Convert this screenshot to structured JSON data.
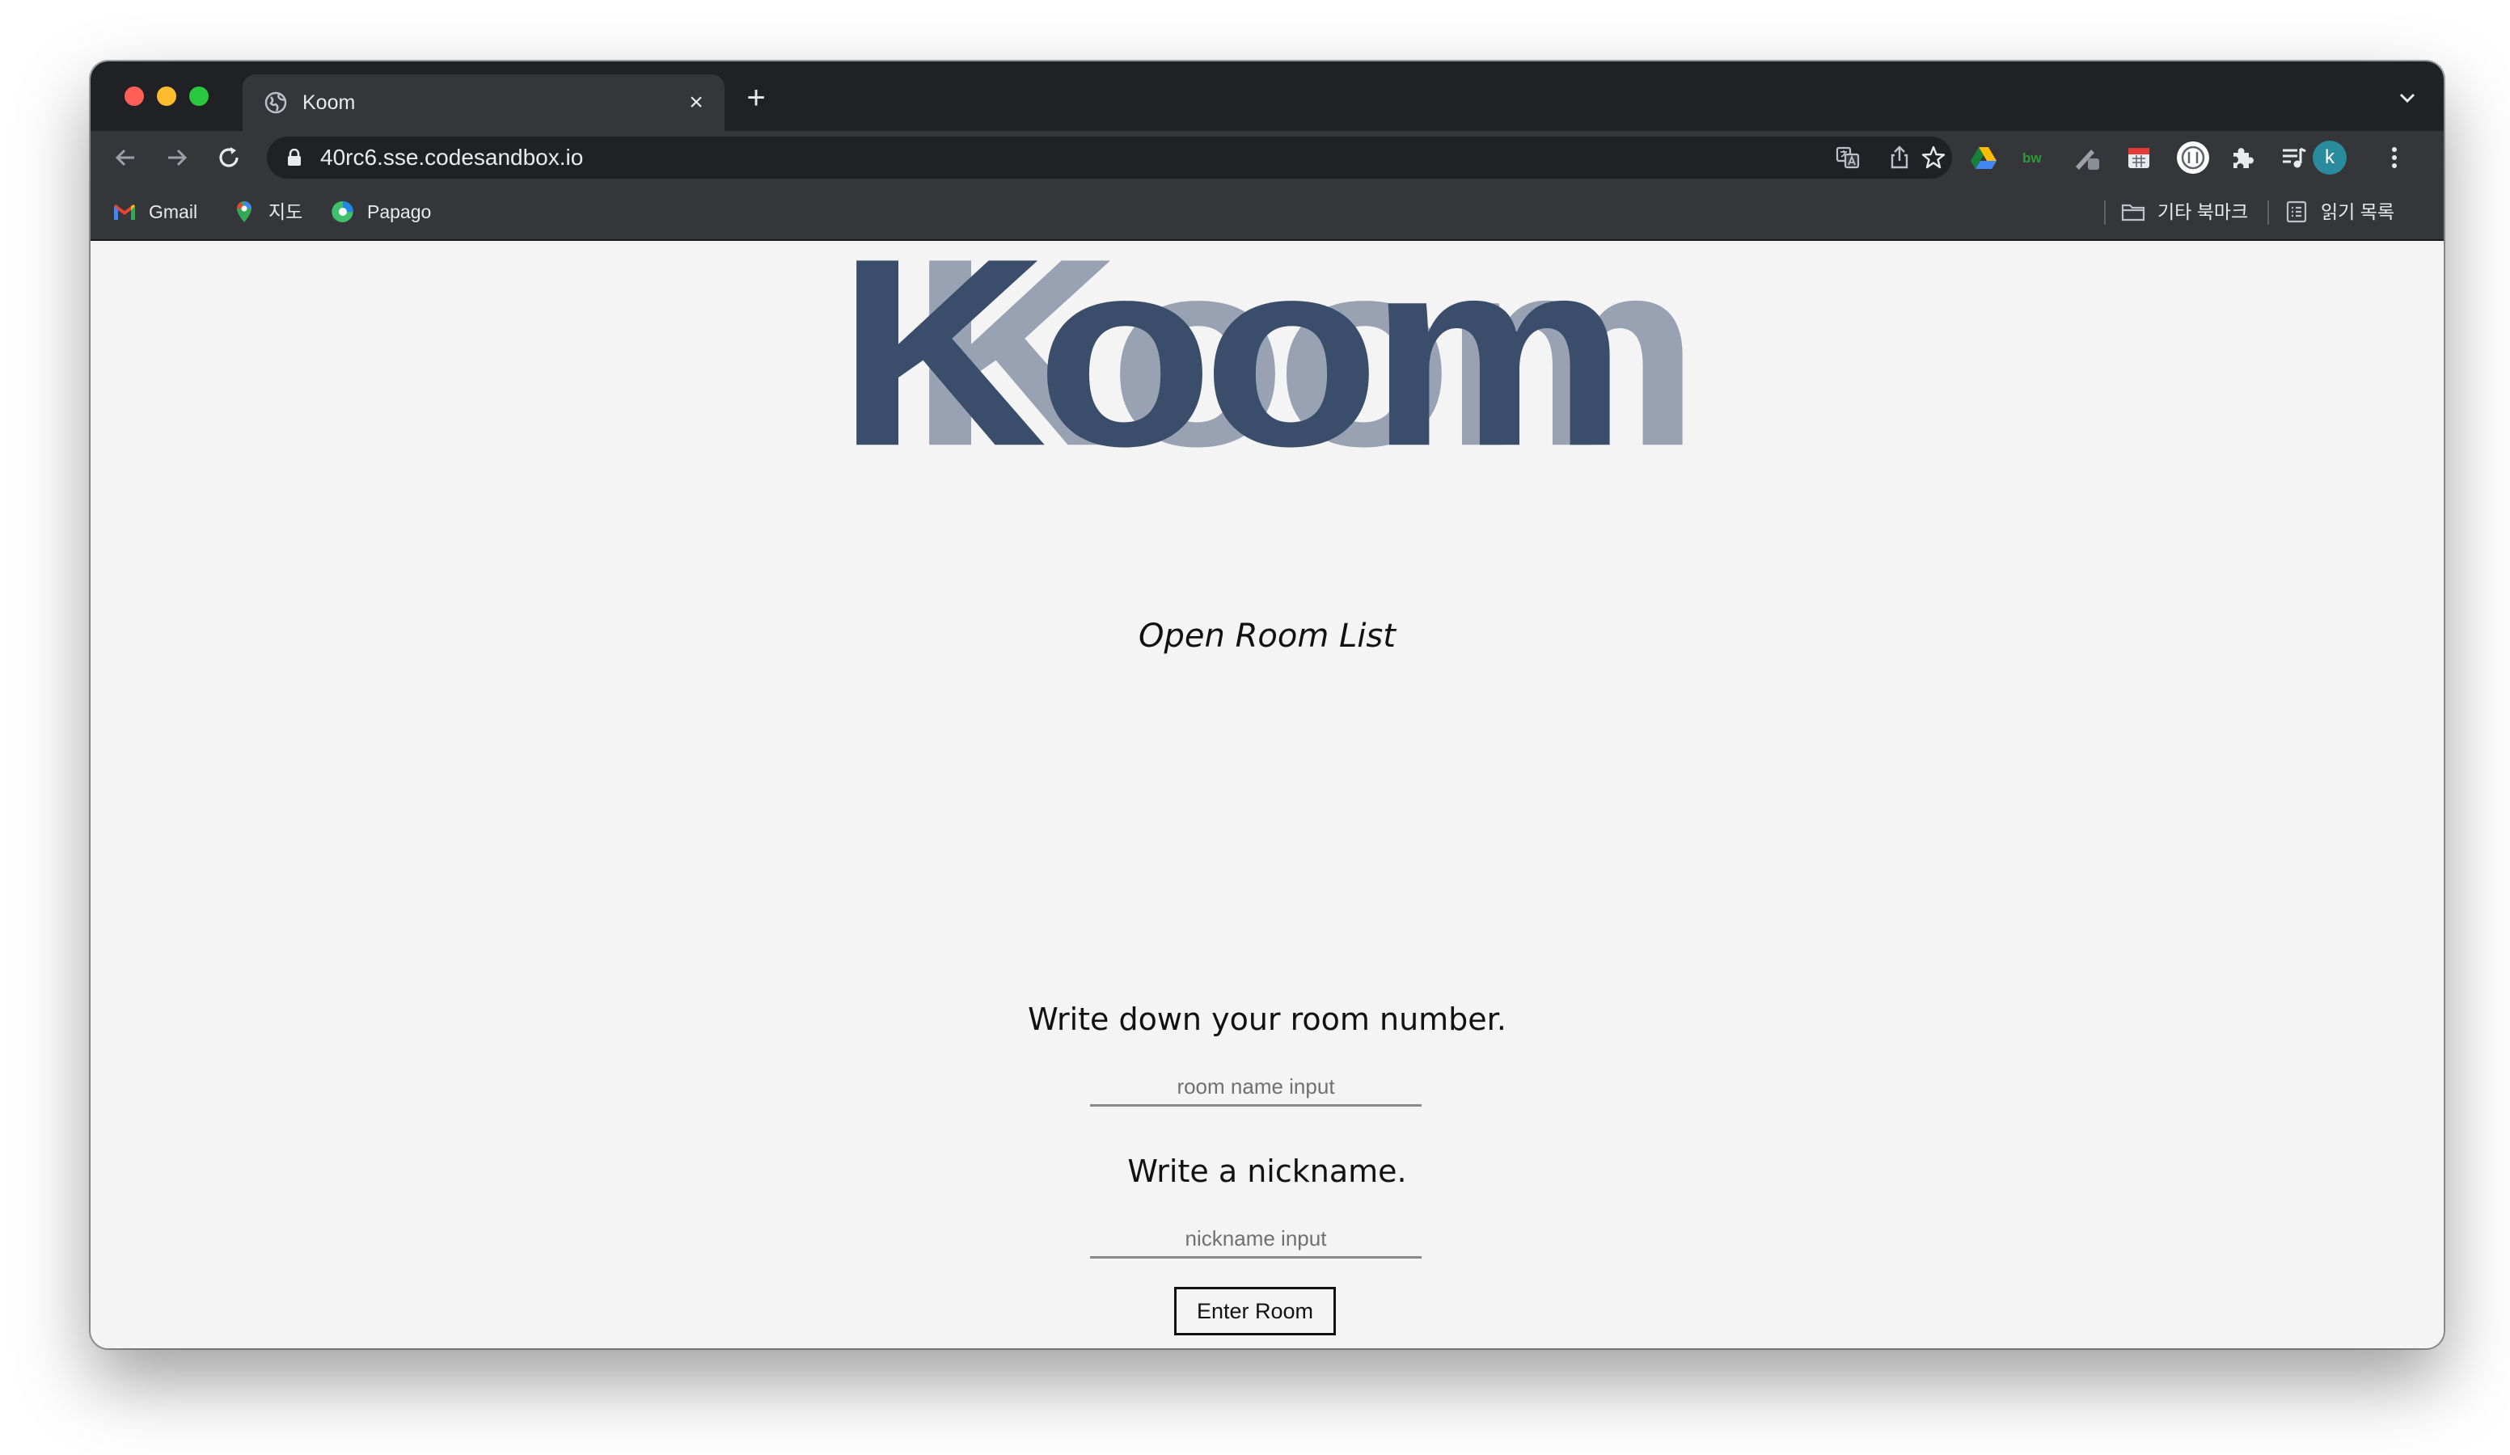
{
  "browser": {
    "tab": {
      "title": "Koom",
      "close_glyph": "×"
    },
    "new_tab_glyph": "+",
    "address_bar": {
      "url": "40rc6.sse.codesandbox.io"
    },
    "profile_initial": "k",
    "bookmarks": [
      {
        "label": "Gmail",
        "icon": "gmail-icon"
      },
      {
        "label": "지도",
        "icon": "maps-icon"
      },
      {
        "label": "Papago",
        "icon": "papago-icon"
      }
    ],
    "other_bookmarks": "기타 북마크",
    "reading_list": "읽기 목록",
    "extensions": [
      "google-drive-icon",
      "bw-extension-icon",
      "pen-extension-icon",
      "calendar-extension-icon",
      "circle-extension-icon",
      "puzzle-icon",
      "media-control-icon"
    ]
  },
  "page": {
    "logo": "Koom",
    "room_list_title": "Open Room List",
    "room_prompt": "Write down your room number.",
    "room_placeholder": "room name input",
    "nickname_prompt": "Write a nickname.",
    "nickname_placeholder": "nickname input",
    "enter_button": "Enter Room"
  },
  "colors": {
    "logo_front": "#3a4d6b",
    "logo_back": "#98a2b2",
    "page_background": "#f4f4f4",
    "chrome_dark": "#202124",
    "chrome_toolbar": "#35363a"
  }
}
